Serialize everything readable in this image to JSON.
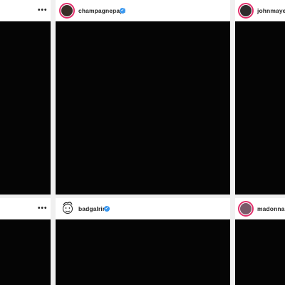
{
  "posts": [
    {
      "username": "",
      "verified": false
    },
    {
      "username": "champagnepapi",
      "verified": true,
      "avatar_color": "#3a3028"
    },
    {
      "username": "johnmayer",
      "verified": false,
      "avatar_color": "#2e2e2e"
    },
    {
      "username": "",
      "verified": false
    },
    {
      "username": "badgalriri",
      "verified": true,
      "avatar_color": "#ffffff"
    },
    {
      "username": "madonna",
      "verified": false,
      "avatar_color": "#7a5a6a"
    }
  ],
  "icons": {
    "more": "•••",
    "verified": "✓"
  },
  "colors": {
    "story_ring": "#e1306c",
    "verified": "#3897f0",
    "media": "#050505",
    "header": "#ffffff",
    "gap": "#f0f0f0"
  }
}
